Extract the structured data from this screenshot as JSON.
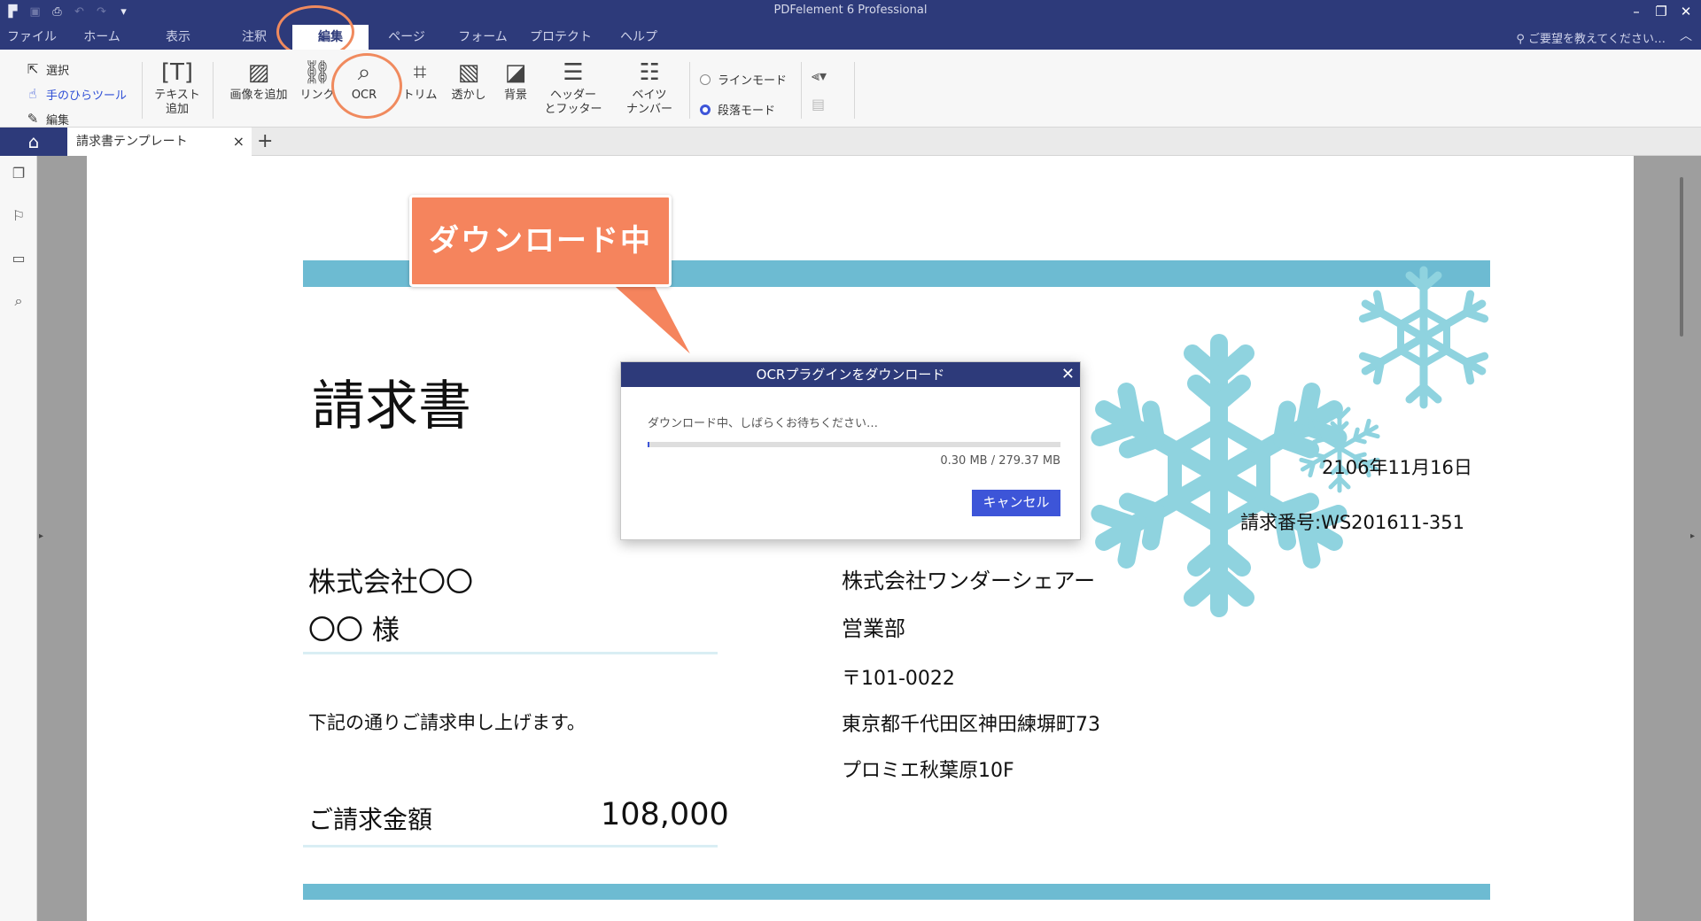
{
  "app": {
    "title": "PDFelement 6 Professional",
    "feedback": "ご要望を教えてください…"
  },
  "menu": [
    "ファイル",
    "ホーム",
    "表示",
    "注釈",
    "編集",
    "ページ",
    "フォーム",
    "プロテクト",
    "ヘルプ"
  ],
  "menu_active": "編集",
  "ribbon": {
    "select": "選択",
    "hand": "手のひらツール",
    "edit": "編集",
    "add_text": "テキスト\n追加",
    "add_image": "画像を追加",
    "link": "リンク",
    "ocr": "OCR",
    "trim": "トリム",
    "watermark": "透かし",
    "background": "背景",
    "header_footer": "ヘッダー\nとフッター",
    "bates": "ベイツ\nナンバー",
    "line_mode": "ラインモード",
    "paragraph_mode": "段落モード"
  },
  "tab": {
    "doc_title": "請求書テンプレート",
    "close_glyph": "×",
    "new_glyph": "+"
  },
  "callout": {
    "text": "ダウンロード中",
    "color": "#f5845d"
  },
  "dialog": {
    "title": "OCRプラグインをダウンロード",
    "message": "ダウンロード中、しばらくお待ちください…",
    "size": "0.30 MB / 279.37 MB",
    "progress": 0.0011,
    "cancel": "キャンセル"
  },
  "document": {
    "title": "請求書",
    "date": "2106年11月16日",
    "invoice_no": "請求番号:WS201611-351",
    "client_company": "株式会社〇〇",
    "client_person": "〇〇 様",
    "intro": "下記の通りご請求申し上げます。",
    "amount_label": "ご請求金額",
    "amount": "108,000",
    "sender_company": "株式会社ワンダーシェアー",
    "sender_dept": "営業部",
    "sender_zip": "〒101-0022",
    "sender_addr": "東京都千代田区神田練塀町73",
    "sender_bldg": "プロミエ秋葉原10F"
  },
  "colors": {
    "titlebar": "#2d3a7a",
    "accent": "#3d55d8",
    "band": "#6dbbd2",
    "snowflake": "#8fd3df",
    "callout_ring": "#f08a5e"
  }
}
